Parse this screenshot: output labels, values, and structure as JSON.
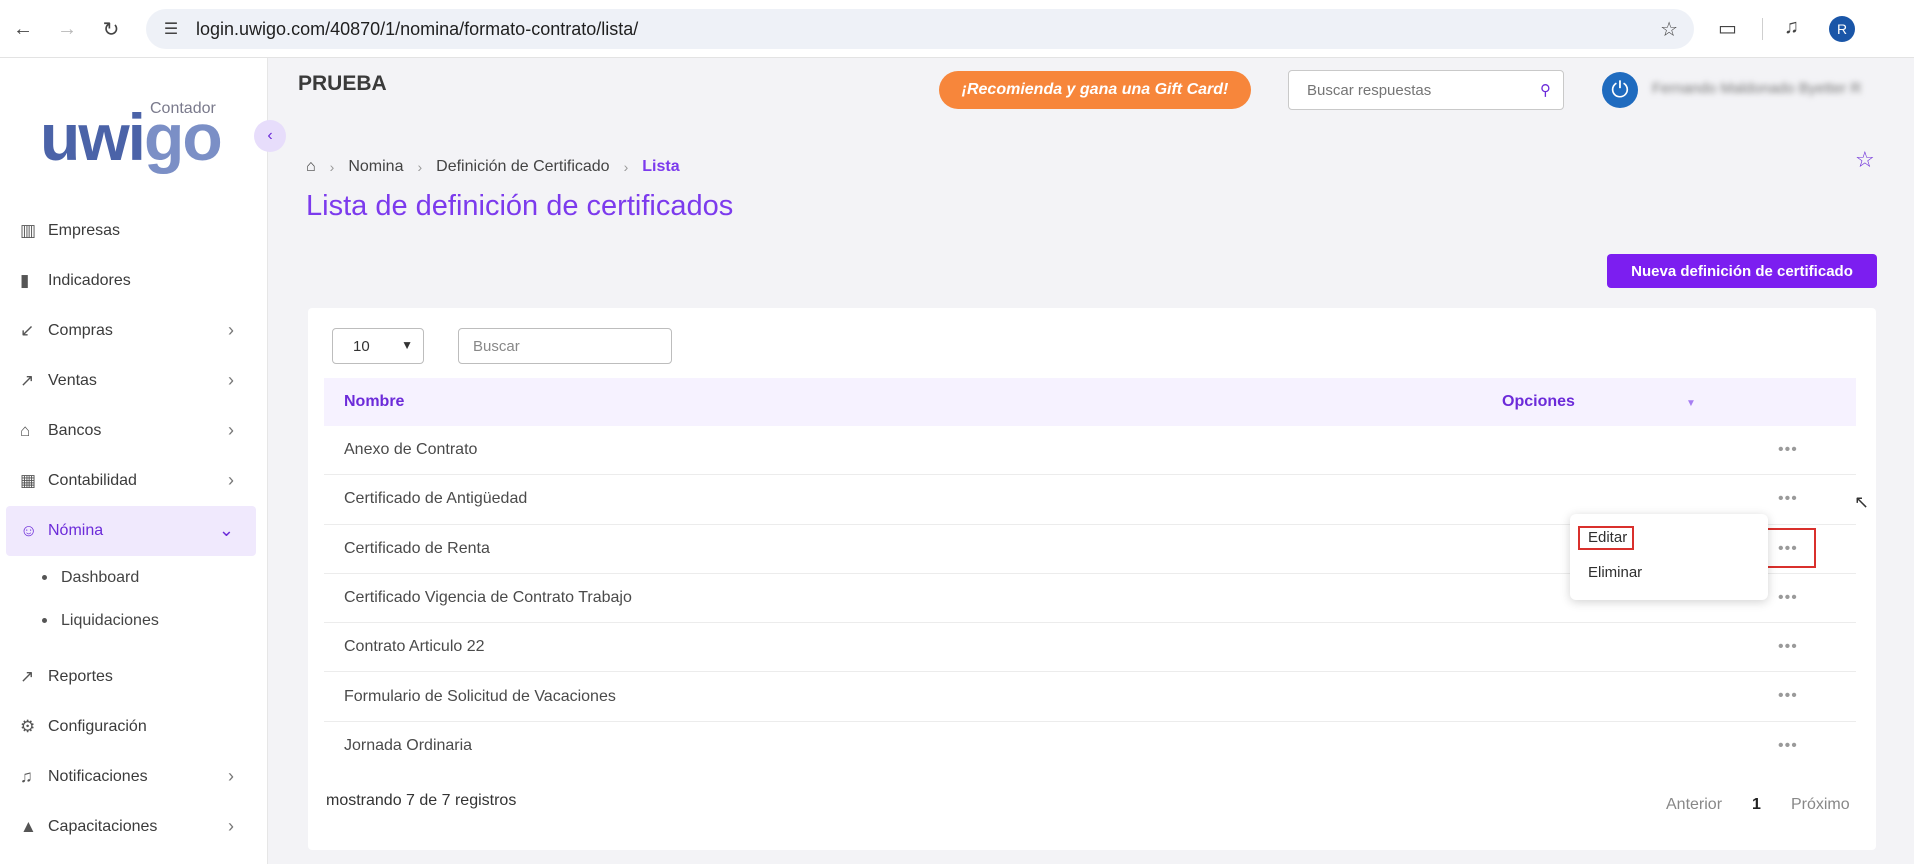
{
  "browser": {
    "url": "login.uwigo.com/40870/1/nomina/formato-contrato/lista/",
    "profile_initial": "R"
  },
  "logo": {
    "contador": "Contador",
    "word_a": "uwi",
    "word_b": "go"
  },
  "sidebar": {
    "items": [
      {
        "label": "Empresas",
        "icon": "building-icon",
        "arrow": false
      },
      {
        "label": "Indicadores",
        "icon": "bar-chart-icon",
        "arrow": false
      },
      {
        "label": "Compras",
        "icon": "arrow-down-left-icon",
        "arrow": true
      },
      {
        "label": "Ventas",
        "icon": "arrow-up-right-icon",
        "arrow": true
      },
      {
        "label": "Bancos",
        "icon": "bank-icon",
        "arrow": true
      },
      {
        "label": "Contabilidad",
        "icon": "calculator-icon",
        "arrow": true
      },
      {
        "label": "Nómina",
        "icon": "users-icon",
        "arrow": true,
        "active": true
      }
    ],
    "subitems": [
      "Dashboard",
      "Liquidaciones"
    ],
    "items_after": [
      {
        "label": "Reportes",
        "icon": "line-chart-icon",
        "arrow": false
      },
      {
        "label": "Configuración",
        "icon": "gear-icon",
        "arrow": false
      },
      {
        "label": "Notificaciones",
        "icon": "bell-icon",
        "arrow": true
      },
      {
        "label": "Capacitaciones",
        "icon": "graduation-cap-icon",
        "arrow": true
      }
    ]
  },
  "header": {
    "company": "PRUEBA",
    "promo": "¡Recomienda y gana una Gift Card!",
    "search_placeholder": "Buscar respuestas",
    "user_name": "Fernando Maldonado Byetter R"
  },
  "breadcrumb": {
    "items": [
      "Nomina",
      "Definición de Certificado"
    ],
    "current": "Lista"
  },
  "page": {
    "title": "Lista de definición de certificados",
    "new_button": "Nueva definición de certificado"
  },
  "table": {
    "page_size": "10",
    "search_placeholder": "Buscar",
    "col_name": "Nombre",
    "col_options": "Opciones",
    "rows": [
      "Anexo de Contrato",
      "Certificado de Antigüedad",
      "Certificado de Renta",
      "Certificado Vigencia de Contrato Trabajo",
      "Contrato Articulo 22",
      "Formulario de Solicitud de Vacaciones",
      "Jornada Ordinaria"
    ],
    "footer": "mostrando 7 de 7 registros",
    "pager": {
      "prev": "Anterior",
      "current": "1",
      "next": "Próximo"
    }
  },
  "context_menu": {
    "edit": "Editar",
    "delete": "Eliminar"
  },
  "colors": {
    "accent": "#7c3aed",
    "button": "#7c1ef0",
    "promo": "#f7863b",
    "highlight": "#d9302c"
  }
}
